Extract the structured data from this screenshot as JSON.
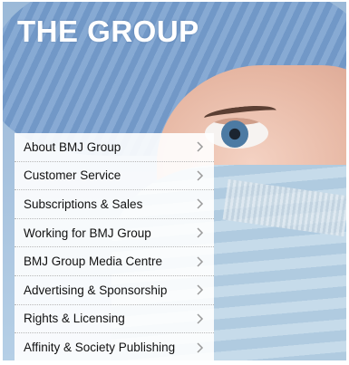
{
  "header": {
    "title": "THE GROUP"
  },
  "menu": {
    "items": [
      {
        "label": "About BMJ Group"
      },
      {
        "label": "Customer Service"
      },
      {
        "label": "Subscriptions & Sales"
      },
      {
        "label": "Working for BMJ Group"
      },
      {
        "label": "BMJ Group Media Centre"
      },
      {
        "label": "Advertising & Sponsorship"
      },
      {
        "label": "Rights & Licensing"
      },
      {
        "label": "Affinity & Society Publishing"
      }
    ],
    "item_icon": "chevron-right-icon"
  },
  "colors": {
    "title": "#ffffff",
    "menu_text": "#111111",
    "menu_bg": "#ffffff"
  }
}
